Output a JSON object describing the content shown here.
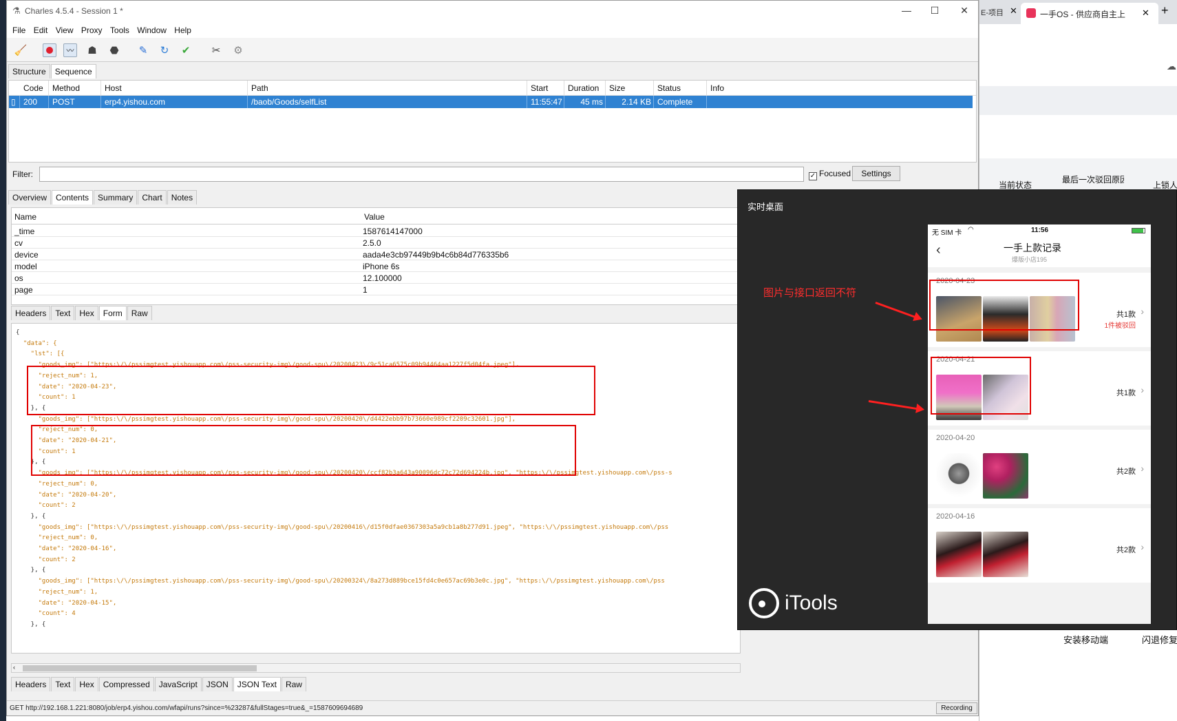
{
  "window": {
    "title": "Charles 4.5.4 - Session 1 *"
  },
  "menu": [
    "File",
    "Edit",
    "View",
    "Proxy",
    "Tools",
    "Window",
    "Help"
  ],
  "toolbar_icons": [
    "broom-icon",
    "record-icon",
    "throttle-icon",
    "turtle-icon",
    "stop-icon",
    "pen-icon",
    "refresh-icon",
    "check-icon",
    "tools-icon",
    "gear-icon"
  ],
  "top_tabs": [
    "Structure",
    "Sequence"
  ],
  "grid": {
    "headers": [
      "Code",
      "Method",
      "Host",
      "Path",
      "Start",
      "Duration",
      "Size",
      "Status",
      "Info"
    ],
    "row": {
      "code": "200",
      "method": "POST",
      "host": "erp4.yishou.com",
      "path": "/baob/Goods/selfList",
      "start": "11:55:47",
      "duration": "45 ms",
      "size": "2.14 KB",
      "status": "Complete",
      "info": ""
    }
  },
  "filter": {
    "label": "Filter:",
    "value": "",
    "focused_label": "Focused",
    "focused_checked": true,
    "settings_label": "Settings"
  },
  "detail_tabs": [
    "Overview",
    "Contents",
    "Summary",
    "Chart",
    "Notes"
  ],
  "kv": {
    "headers": [
      "Name",
      "Value"
    ],
    "rows": [
      {
        "k": "_time",
        "v": "1587614147000"
      },
      {
        "k": "cv",
        "v": "2.5.0"
      },
      {
        "k": "device",
        "v": "aada4e3cb97449b9b4c6b84d776335b6"
      },
      {
        "k": "model",
        "v": "iPhone 6s"
      },
      {
        "k": "os",
        "v": "12.100000"
      },
      {
        "k": "page",
        "v": "1"
      }
    ]
  },
  "form_tabs": [
    "Headers",
    "Text",
    "Hex",
    "Form",
    "Raw"
  ],
  "json_lines": [
    "{",
    "  \"data\": {",
    "    \"lst\": [{",
    "      \"goods_img\": [\"https:\\/\\/pssimgtest.yishouapp.com\\/pss-security-img\\/good-spu\\/20200423\\/9c51ca6575c09b94464aa1227f5d04fa.jpeg\"],",
    "      \"reject_num\": 1,",
    "      \"date\": \"2020-04-23\",",
    "      \"count\": 1",
    "    }, {",
    "      \"goods_img\": [\"https:\\/\\/pssimgtest.yishouapp.com\\/pss-security-img\\/good-spu\\/20200420\\/d4422ebb97b73660e989cf2209c32601.jpg\"],",
    "      \"reject_num\": 0,",
    "      \"date\": \"2020-04-21\",",
    "      \"count\": 1",
    "    }, {",
    "      \"goods_img\": [\"https:\\/\\/pssimgtest.yishouapp.com\\/pss-security-img\\/good-spu\\/20200420\\/ccf82b3a643a90096dc72c72d694224b.jpg\", \"https:\\/\\/pssimgtest.yishouapp.com\\/pss-s",
    "      \"reject_num\": 0,",
    "      \"date\": \"2020-04-20\",",
    "      \"count\": 2",
    "    }, {",
    "      \"goods_img\": [\"https:\\/\\/pssimgtest.yishouapp.com\\/pss-security-img\\/good-spu\\/20200416\\/d15f0dfae0367303a5a9cb1a8b277d91.jpeg\", \"https:\\/\\/pssimgtest.yishouapp.com\\/pss",
    "      \"reject_num\": 0,",
    "      \"date\": \"2020-04-16\",",
    "      \"count\": 2",
    "    }, {",
    "      \"goods_img\": [\"https:\\/\\/pssimgtest.yishouapp.com\\/pss-security-img\\/good-spu\\/20200324\\/8a273d889bce15fd4c0e657ac69b3e0c.jpg\", \"https:\\/\\/pssimgtest.yishouapp.com\\/pss",
    "      \"reject_num\": 1,",
    "      \"date\": \"2020-04-15\",",
    "      \"count\": 4",
    "    }, {"
  ],
  "bottom_tabs": [
    "Headers",
    "Text",
    "Hex",
    "Compressed",
    "JavaScript",
    "JSON",
    "JSON Text",
    "Raw"
  ],
  "status": {
    "url": "GET http://192.168.1.221:8080/job/erp4.yishou.com/wfapi/runs?since=%23287&fullStages=true&_=1587609694689",
    "recording": "Recording"
  },
  "browser": {
    "tab1": "E-项目",
    "tab2": "一手OS - 供应商自主上",
    "col1": "当前状态",
    "col2": "最后一次驳回原因",
    "col3": "上锁人",
    "foot1": "安装移动端",
    "foot2": "闪退修复"
  },
  "itools": {
    "title": "实时桌面",
    "brand": "iTools",
    "annotation": "图片与接口返回不符",
    "phone": {
      "carrier": "无 SIM 卡",
      "time": "11:56",
      "page_title": "一手上款记录",
      "subtitle": "爆版小店195",
      "cards": [
        {
          "date": "2020-04-23",
          "count": "共1款",
          "reject": "1件被驳回"
        },
        {
          "date": "2020-04-21",
          "count": "共1款",
          "reject": ""
        },
        {
          "date": "2020-04-20",
          "count": "共2款",
          "reject": ""
        },
        {
          "date": "2020-04-16",
          "count": "共2款",
          "reject": ""
        }
      ]
    }
  }
}
